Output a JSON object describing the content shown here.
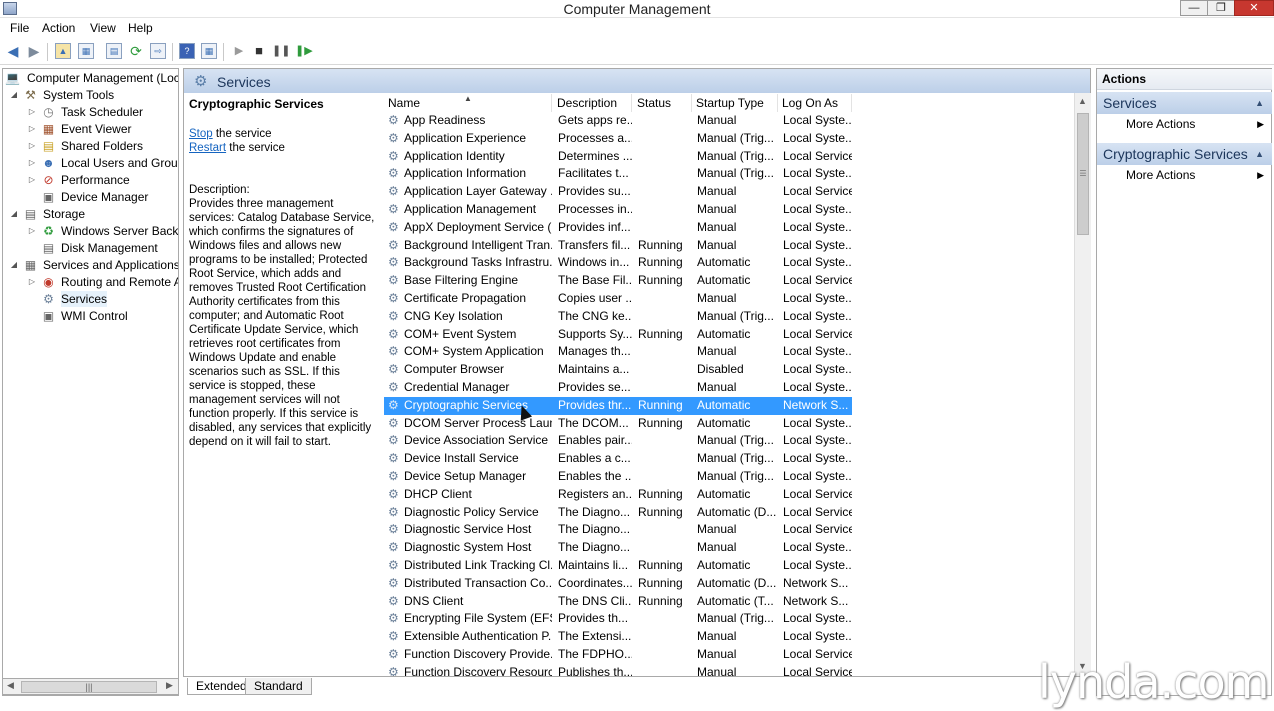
{
  "window": {
    "title": "Computer Management"
  },
  "menu": [
    "File",
    "Action",
    "View",
    "Help"
  ],
  "tree": {
    "root": "Computer Management (Local",
    "system_tools": "System Tools",
    "task_scheduler": "Task Scheduler",
    "event_viewer": "Event Viewer",
    "shared_folders": "Shared Folders",
    "local_users": "Local Users and Groups",
    "performance": "Performance",
    "device_manager": "Device Manager",
    "storage": "Storage",
    "windows_backup": "Windows Server Backup",
    "disk_management": "Disk Management",
    "services_apps": "Services and Applications",
    "routing": "Routing and Remote Ac",
    "services": "Services",
    "wmi": "WMI Control"
  },
  "panel": {
    "header": "Services",
    "selected_name": "Cryptographic Services",
    "stop_link": "Stop",
    "stop_rest": " the service",
    "restart_link": "Restart",
    "restart_rest": " the service",
    "description_label": "Description:",
    "description_text": "Provides three management services: Catalog Database Service, which confirms the signatures of Windows files and allows new programs to be installed; Protected Root Service, which adds and removes Trusted Root Certification Authority certificates from this computer; and Automatic Root Certificate Update Service, which retrieves root certificates from Windows Update and enable scenarios such as SSL. If this service is stopped, these management services will not function properly. If this service is disabled, any services that explicitly depend on it will fail to start."
  },
  "columns": {
    "name": "Name",
    "description": "Description",
    "status": "Status",
    "startup": "Startup Type",
    "logon": "Log On As"
  },
  "services": [
    {
      "name": "App Readiness",
      "desc": "Gets apps re...",
      "status": "",
      "startup": "Manual",
      "logon": "Local Syste..."
    },
    {
      "name": "Application Experience",
      "desc": "Processes a...",
      "status": "",
      "startup": "Manual (Trig...",
      "logon": "Local Syste..."
    },
    {
      "name": "Application Identity",
      "desc": "Determines ...",
      "status": "",
      "startup": "Manual (Trig...",
      "logon": "Local Service"
    },
    {
      "name": "Application Information",
      "desc": "Facilitates t...",
      "status": "",
      "startup": "Manual (Trig...",
      "logon": "Local Syste..."
    },
    {
      "name": "Application Layer Gateway ...",
      "desc": "Provides su...",
      "status": "",
      "startup": "Manual",
      "logon": "Local Service"
    },
    {
      "name": "Application Management",
      "desc": "Processes in...",
      "status": "",
      "startup": "Manual",
      "logon": "Local Syste..."
    },
    {
      "name": "AppX Deployment Service (...",
      "desc": "Provides inf...",
      "status": "",
      "startup": "Manual",
      "logon": "Local Syste..."
    },
    {
      "name": "Background Intelligent Tran...",
      "desc": "Transfers fil...",
      "status": "Running",
      "startup": "Manual",
      "logon": "Local Syste..."
    },
    {
      "name": "Background Tasks Infrastru...",
      "desc": "Windows in...",
      "status": "Running",
      "startup": "Automatic",
      "logon": "Local Syste..."
    },
    {
      "name": "Base Filtering Engine",
      "desc": "The Base Fil...",
      "status": "Running",
      "startup": "Automatic",
      "logon": "Local Service"
    },
    {
      "name": "Certificate Propagation",
      "desc": "Copies user ...",
      "status": "",
      "startup": "Manual",
      "logon": "Local Syste..."
    },
    {
      "name": "CNG Key Isolation",
      "desc": "The CNG ke...",
      "status": "",
      "startup": "Manual (Trig...",
      "logon": "Local Syste..."
    },
    {
      "name": "COM+ Event System",
      "desc": "Supports Sy...",
      "status": "Running",
      "startup": "Automatic",
      "logon": "Local Service"
    },
    {
      "name": "COM+ System Application",
      "desc": "Manages th...",
      "status": "",
      "startup": "Manual",
      "logon": "Local Syste..."
    },
    {
      "name": "Computer Browser",
      "desc": "Maintains a...",
      "status": "",
      "startup": "Disabled",
      "logon": "Local Syste..."
    },
    {
      "name": "Credential Manager",
      "desc": "Provides se...",
      "status": "",
      "startup": "Manual",
      "logon": "Local Syste..."
    },
    {
      "name": "Cryptographic Services",
      "desc": "Provides thr...",
      "status": "Running",
      "startup": "Automatic",
      "logon": "Network S..."
    },
    {
      "name": "DCOM Server Process Laun...",
      "desc": "The DCOM...",
      "status": "Running",
      "startup": "Automatic",
      "logon": "Local Syste..."
    },
    {
      "name": "Device Association Service",
      "desc": "Enables pair...",
      "status": "",
      "startup": "Manual (Trig...",
      "logon": "Local Syste..."
    },
    {
      "name": "Device Install Service",
      "desc": "Enables a c...",
      "status": "",
      "startup": "Manual (Trig...",
      "logon": "Local Syste..."
    },
    {
      "name": "Device Setup Manager",
      "desc": "Enables the ...",
      "status": "",
      "startup": "Manual (Trig...",
      "logon": "Local Syste..."
    },
    {
      "name": "DHCP Client",
      "desc": "Registers an...",
      "status": "Running",
      "startup": "Automatic",
      "logon": "Local Service"
    },
    {
      "name": "Diagnostic Policy Service",
      "desc": "The Diagno...",
      "status": "Running",
      "startup": "Automatic (D...",
      "logon": "Local Service"
    },
    {
      "name": "Diagnostic Service Host",
      "desc": "The Diagno...",
      "status": "",
      "startup": "Manual",
      "logon": "Local Service"
    },
    {
      "name": "Diagnostic System Host",
      "desc": "The Diagno...",
      "status": "",
      "startup": "Manual",
      "logon": "Local Syste..."
    },
    {
      "name": "Distributed Link Tracking Cl...",
      "desc": "Maintains li...",
      "status": "Running",
      "startup": "Automatic",
      "logon": "Local Syste..."
    },
    {
      "name": "Distributed Transaction Co...",
      "desc": "Coordinates...",
      "status": "Running",
      "startup": "Automatic (D...",
      "logon": "Network S..."
    },
    {
      "name": "DNS Client",
      "desc": "The DNS Cli...",
      "status": "Running",
      "startup": "Automatic (T...",
      "logon": "Network S..."
    },
    {
      "name": "Encrypting File System (EFS)",
      "desc": "Provides th...",
      "status": "",
      "startup": "Manual (Trig...",
      "logon": "Local Syste..."
    },
    {
      "name": "Extensible Authentication P...",
      "desc": "The Extensi...",
      "status": "",
      "startup": "Manual",
      "logon": "Local Syste..."
    },
    {
      "name": "Function Discovery Provide...",
      "desc": "The FDPHO...",
      "status": "",
      "startup": "Manual",
      "logon": "Local Service"
    },
    {
      "name": "Function Discovery Resourc...",
      "desc": "Publishes th...",
      "status": "",
      "startup": "Manual",
      "logon": "Local Service"
    }
  ],
  "tabs": [
    "Extended",
    "Standard"
  ],
  "actions": {
    "title": "Actions",
    "section1": "Services",
    "section2": "Cryptographic Services",
    "more_actions": "More Actions"
  },
  "watermark": "lynda.com",
  "colors": {
    "selection": "#3399ff",
    "panel_header": "#c9d9ee",
    "link": "#1564c0"
  }
}
